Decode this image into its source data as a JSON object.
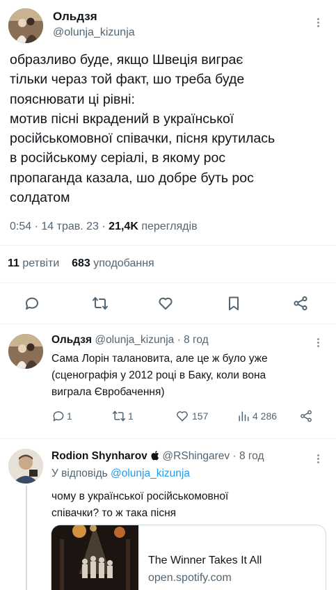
{
  "main_tweet": {
    "author_name": "Ольдзя",
    "author_handle": "@olunja_kizunja",
    "text_lines": [
      "образливо буде, якщо Швеція виграє",
      "тільки черaз той факт, шо треба буде",
      "пояснювати ці рівні:",
      "мотив пісні вкрадений в української",
      "російськомовної співачки, пісня крутилась",
      "в російському серіалі, в якому рос",
      "пропаганда казала, шо добре буть рос",
      "солдатом"
    ],
    "time": "0:54",
    "date": "14 трав. 23",
    "views_count": "21,4K",
    "views_label": "переглядів",
    "retweets_count": "11",
    "retweets_label": "ретвіти",
    "likes_count": "683",
    "likes_label": "уподобання"
  },
  "action_icons": [
    "reply-icon",
    "retweet-icon",
    "like-icon",
    "bookmark-icon",
    "share-icon"
  ],
  "reply1": {
    "author_name": "Ольдзя",
    "author_handle": "@olunja_kizunja",
    "age": "8 год",
    "text_lines": [
      "Сама Лорін талановита, але це ж було уже",
      "(сценографія у 2012 році в Баку, коли вона",
      "виграла Євробачення)"
    ],
    "replies": "1",
    "retweets": "1",
    "likes": "157",
    "views": "4 286"
  },
  "reply2": {
    "author_name": "Rodion Shynharov",
    "author_handle": "@RShingarev",
    "age": "8 год",
    "reply_to_prefix": "У відповідь",
    "reply_to_handle": "@olunja_kizunja",
    "text_lines": [
      "чому в української російськомовної",
      "співачки? то ж така пісня"
    ],
    "card_title": "The Winner Takes It All",
    "card_domain": "open.spotify.com"
  }
}
